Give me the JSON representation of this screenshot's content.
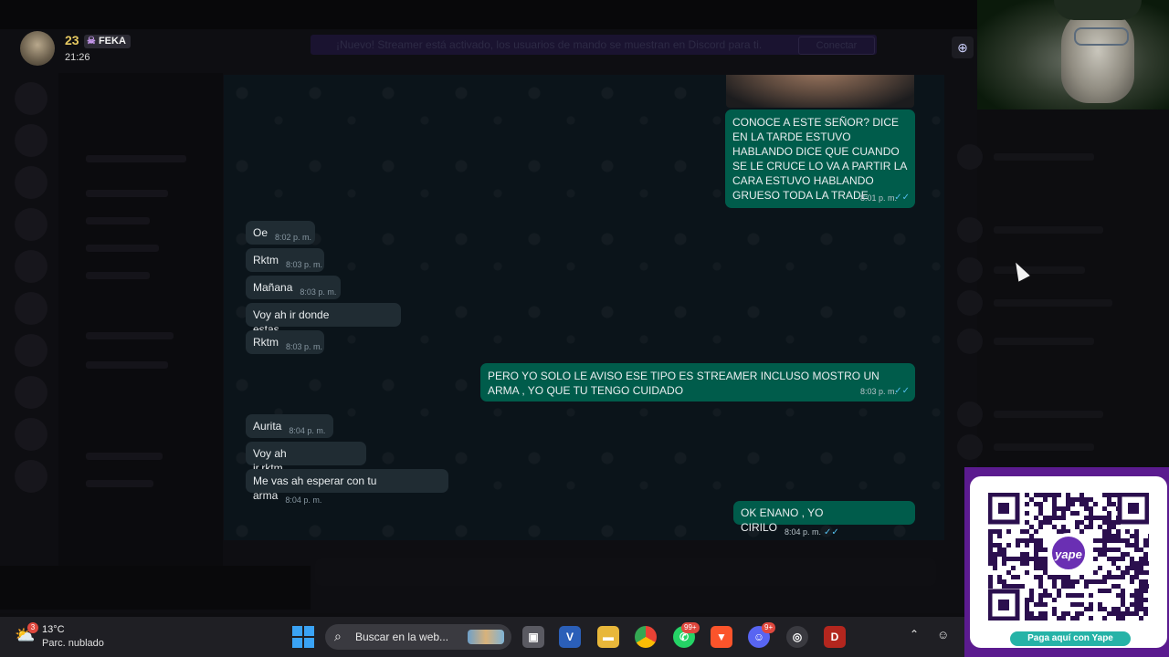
{
  "stream_overlay": {
    "viewer_count": "23",
    "tag": "FEKA",
    "time": "21:26"
  },
  "background_ui": {
    "banner_text": "¡Nuevo! Streamer está activado, los usuarios de mando se muestran en Discord para ti.",
    "banner_button": "Conectar"
  },
  "chat": {
    "messages": [
      {
        "dir": "out",
        "text": "CONOCE A ESTE SEÑOR? DICE EN LA TARDE ESTUVO HABLANDO DICE QUE CUANDO SE LE CRUCE LO VA A PARTIR LA CARA ESTUVO HABLANDO GRUESO TODA LA TRADE",
        "time": "8:01 p. m."
      },
      {
        "dir": "in",
        "text": "Oe",
        "time": "8:02 p. m."
      },
      {
        "dir": "in",
        "text": "Rktm",
        "time": "8:03 p. m."
      },
      {
        "dir": "in",
        "text": "Mañana",
        "time": "8:03 p. m."
      },
      {
        "dir": "in",
        "text": "Voy ah ir donde estas",
        "time": "8:03 p. m."
      },
      {
        "dir": "in",
        "text": "Rktm",
        "time": "8:03 p. m."
      },
      {
        "dir": "out",
        "text": "PERO YO SOLO LE AVISO ESE TIPO ES STREAMER INCLUSO MOSTRO UN ARMA , YO QUE TU TENGO CUIDADO",
        "time": "8:03 p. m."
      },
      {
        "dir": "in",
        "text": "Aurita",
        "time": "8:04 p. m."
      },
      {
        "dir": "in",
        "text": "Voy ah ir.rktm",
        "time": "8:04 p. m."
      },
      {
        "dir": "in",
        "text": "Me vas ah esperar con tu arma",
        "time": "8:04 p. m."
      },
      {
        "dir": "out",
        "text": "OK ENANO , YO CIRILO",
        "time": "8:04 p. m."
      }
    ]
  },
  "qr": {
    "label": "Paga aquí con Yape"
  },
  "taskbar": {
    "weather_temp": "13°C",
    "weather_desc": "Parc. nublado",
    "weather_badge": "3",
    "search_text": "Buscar en la web...",
    "whatsapp_badge": "99+",
    "discord_badge": "9+"
  },
  "colors": {
    "outgoing_bubble": "#005c4b",
    "incoming_bubble": "#202c33",
    "chat_bg": "#0b141a",
    "qr_panel": "#5b1b8f",
    "yape_label": "#26b3a7"
  }
}
